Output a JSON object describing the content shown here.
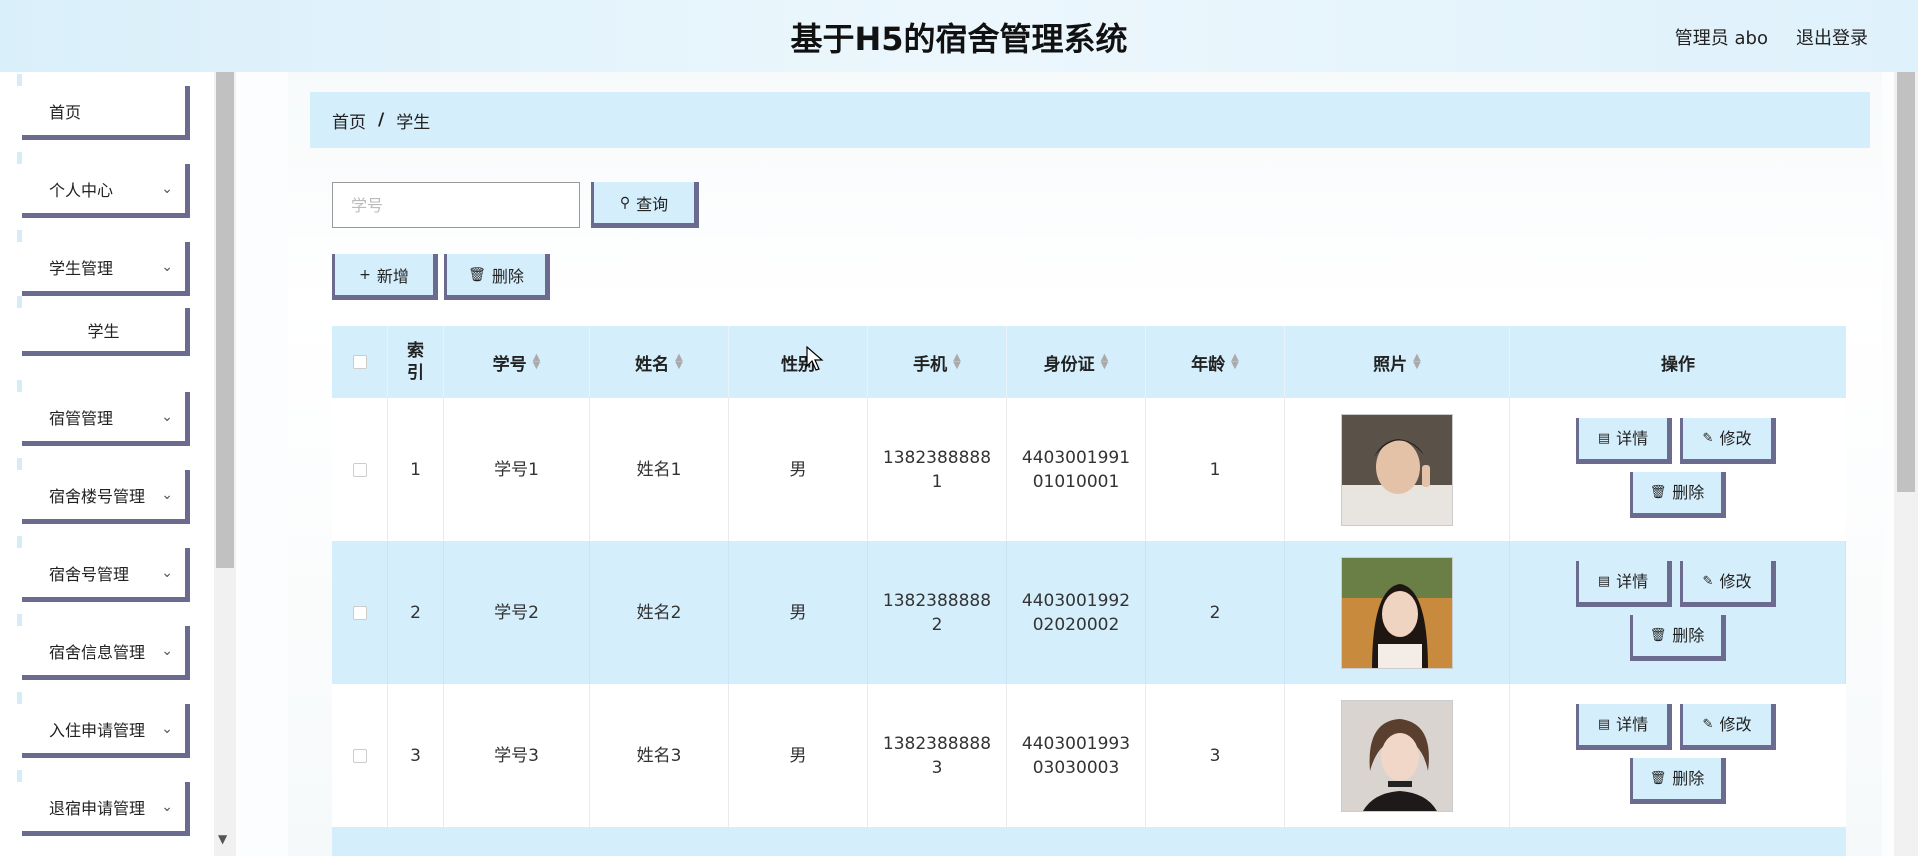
{
  "header": {
    "title": "基于H5的宿舍管理系统",
    "user": "管理员 abo",
    "logout": "退出登录"
  },
  "sidebar": {
    "items": [
      {
        "label": "首页",
        "expandable": false
      },
      {
        "label": "个人中心",
        "expandable": true
      },
      {
        "label": "学生管理",
        "expandable": true
      },
      {
        "label": "学生",
        "expandable": false,
        "sub": true
      },
      {
        "label": "宿管管理",
        "expandable": true
      },
      {
        "label": "宿舍楼号管理",
        "expandable": true
      },
      {
        "label": "宿舍号管理",
        "expandable": true
      },
      {
        "label": "宿舍信息管理",
        "expandable": true
      },
      {
        "label": "入住申请管理",
        "expandable": true
      },
      {
        "label": "退宿申请管理",
        "expandable": true
      }
    ]
  },
  "breadcrumb": {
    "home": "首页",
    "separator": "/",
    "current": "学生"
  },
  "search": {
    "placeholder": "学号",
    "button": "查询"
  },
  "toolbar": {
    "add": "新增",
    "delete": "删除"
  },
  "table": {
    "headers": [
      "",
      "索引",
      "学号",
      "姓名",
      "性别",
      "手机",
      "身份证",
      "年龄",
      "照片",
      "操作"
    ],
    "rows": [
      {
        "index": "1",
        "student_no": "学号1",
        "name": "姓名1",
        "gender": "男",
        "phone": "13823888881",
        "id_card": "440300199101010001",
        "age": "1"
      },
      {
        "index": "2",
        "student_no": "学号2",
        "name": "姓名2",
        "gender": "男",
        "phone": "13823888882",
        "id_card": "440300199202020002",
        "age": "2"
      },
      {
        "index": "3",
        "student_no": "学号3",
        "name": "姓名3",
        "gender": "男",
        "phone": "13823888883",
        "id_card": "440300199303030003",
        "age": "3"
      }
    ],
    "ops": {
      "detail": "详情",
      "edit": "修改",
      "delete": "删除"
    }
  },
  "colors": {
    "accent": "#d4eefb",
    "border": "#6b6b8f"
  }
}
